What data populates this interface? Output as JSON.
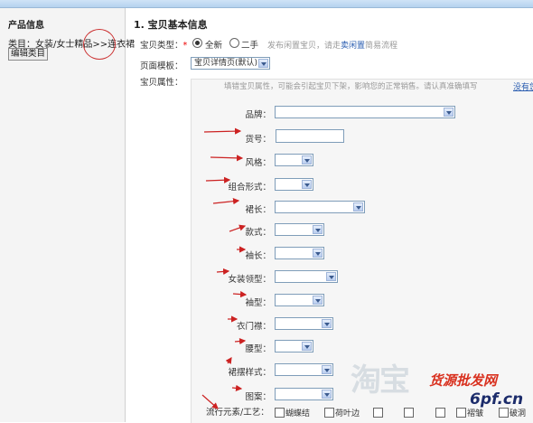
{
  "sidebar": {
    "title": "产品信息",
    "category_label": "类目：",
    "category_value": "女装/女士精品>>连衣裙",
    "edit_button": "编辑类目"
  },
  "section": {
    "title": "1. 宝贝基本信息",
    "item_type_label": "宝贝类型：",
    "required_mark": "*",
    "type_new": "全新",
    "type_used": "二手",
    "type_selected": "全新",
    "used_hint_prefix": "发布闲置宝贝，请走",
    "used_hint_link": "卖闲置",
    "used_hint_suffix": "简易流程",
    "template_label": "页面模板：",
    "template_value": "宝贝详情页(默认)",
    "attrs_label": "宝贝属性：",
    "attrs_hint": "填错宝贝属性，可能会引起宝贝下架，影响您的正常销售。请认真准确填写",
    "attrs_link": "没有您"
  },
  "attributes": [
    {
      "label": "品牌：",
      "kind": "select",
      "value": ""
    },
    {
      "label": "货号：",
      "kind": "text",
      "value": ""
    },
    {
      "label": "风格：",
      "kind": "select",
      "value": ""
    },
    {
      "label": "组合形式：",
      "kind": "select",
      "value": ""
    },
    {
      "label": "裙长：",
      "kind": "select",
      "value": ""
    },
    {
      "label": "款式：",
      "kind": "select",
      "value": ""
    },
    {
      "label": "袖长：",
      "kind": "select",
      "value": ""
    },
    {
      "label": "女装领型：",
      "kind": "select",
      "value": ""
    },
    {
      "label": "袖型：",
      "kind": "select",
      "value": ""
    },
    {
      "label": "衣门襟：",
      "kind": "select",
      "value": ""
    },
    {
      "label": "腰型：",
      "kind": "select",
      "value": ""
    },
    {
      "label": "裙摆样式：",
      "kind": "select",
      "value": ""
    },
    {
      "label": "图案：",
      "kind": "select",
      "value": ""
    }
  ],
  "elements": {
    "label": "流行元素/工艺：",
    "options": [
      "蝴蝶结",
      "荷叶边",
      "",
      "",
      "",
      "褶皱",
      "破洞"
    ]
  },
  "watermark": {
    "text1": "淘宝",
    "text2": "货源批发网",
    "text3": "6pf.cn"
  },
  "colors": {
    "annotation_red": "#cc2222",
    "link_blue": "#2a5db0"
  }
}
